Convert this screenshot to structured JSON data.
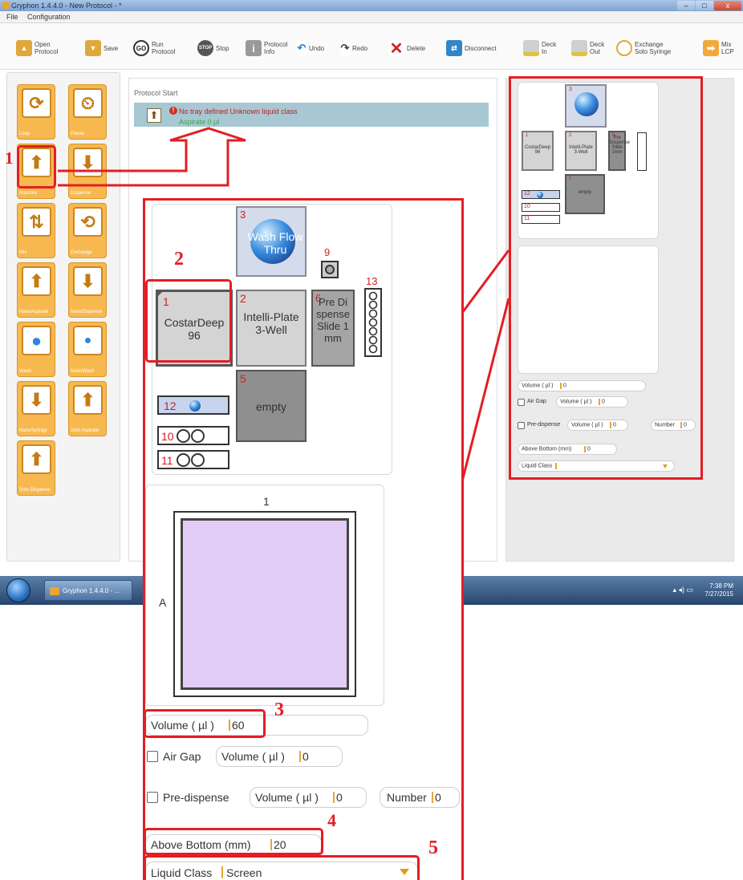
{
  "window": {
    "title": "Gryphon 1.4.4.0 - New Protocol - *",
    "controls": [
      "–",
      "□",
      "x"
    ]
  },
  "menu": {
    "file": "File",
    "configuration": "Configuration"
  },
  "toolbar": {
    "open": "Open Protocol",
    "save": "Save",
    "run": "Run Protocol",
    "stop": "Stop",
    "info": "Protocol Info",
    "undo": "Undo",
    "redo": "Redo",
    "delete": "Delete",
    "disconnect": "Disconnect",
    "deck_in": "Deck In",
    "deck_out": "Deck Out",
    "exchange": "Exchange Solo Syringe",
    "mix_lcp": "Mix LCP"
  },
  "commands": [
    {
      "label": "Loop",
      "glyph": "⟳"
    },
    {
      "label": "Pause",
      "glyph": "⏲"
    },
    {
      "label": "Aspirate",
      "glyph": "⬆"
    },
    {
      "label": "Dispense",
      "glyph": "⬇"
    },
    {
      "label": "Mix",
      "glyph": "⇅"
    },
    {
      "label": "Exchange",
      "glyph": "⟲"
    },
    {
      "label": "NanoAspirate",
      "glyph": "⬆"
    },
    {
      "label": "NanoDispense",
      "glyph": "⬇"
    },
    {
      "label": "Wash",
      "glyph": "●"
    },
    {
      "label": "NanoWash",
      "glyph": "●"
    },
    {
      "label": "NanoSyringe",
      "glyph": "⬇"
    },
    {
      "label": "Solo Aspirate",
      "glyph": "⬆"
    },
    {
      "label": "Solo Dispense",
      "glyph": "⬆"
    }
  ],
  "protocol": {
    "start_label": "Protocol Start",
    "error": "No tray defined Unknown liquid class",
    "sub": "Aspirate 0 µl"
  },
  "deck": {
    "wash": {
      "num": "3",
      "name": "Wash Flow Thru"
    },
    "costar": {
      "num": "1",
      "name": "CostarDeep 96"
    },
    "intelli": {
      "num": "2",
      "name": "Intelli-Plate 3-Well"
    },
    "pre": {
      "num": "6",
      "name": "Pre Dispense Slide 1mm"
    },
    "empty": {
      "num": "5",
      "name": "empty"
    },
    "pos9": "9",
    "pos13": "13",
    "pos12": "12",
    "pos10": "10",
    "pos11": "11"
  },
  "plate_view": {
    "col": "1",
    "row": "A",
    "well_color": "#e0ccf5"
  },
  "form": {
    "volume_label": "Volume ( µl )",
    "volume_value": "60",
    "air_gap_label": "Air Gap",
    "air_gap_volume_label": "Volume ( µl )",
    "air_gap_volume_value": "0",
    "predispense_label": "Pre-dispense",
    "predispense_volume_label": "Volume ( µl )",
    "predispense_volume_value": "0",
    "number_label": "Number",
    "number_value": "0",
    "above_bottom_label": "Above Bottom (mm)",
    "above_bottom_value": "20",
    "liquid_class_label": "Liquid Class",
    "liquid_class_value": "Screen"
  },
  "small_form": {
    "volume_value": "0",
    "air_gap_volume_value": "0",
    "predispense_volume_value": "0",
    "number_value": "0",
    "above_bottom_value": "0",
    "liquid_class_value": ""
  },
  "callouts": [
    "1",
    "2",
    "3",
    "4",
    "5"
  ],
  "taskbar": {
    "app": "Gryphon 1.4.4.0 - ...",
    "time": "7:38 PM",
    "date": "7/27/2015"
  },
  "colors": {
    "highlight": "#e31e24",
    "accent": "#f7b84f"
  }
}
